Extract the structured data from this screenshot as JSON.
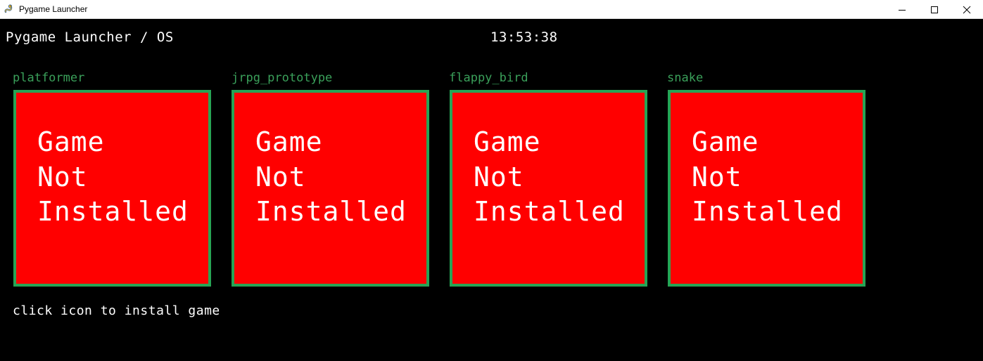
{
  "window": {
    "title": "Pygame Launcher",
    "icon": "pygame-snake-icon",
    "controls": [
      "minimize-icon",
      "maximize-icon",
      "close-icon"
    ]
  },
  "header": {
    "title": "Pygame Launcher / OS",
    "clock": "13:53:38"
  },
  "games": [
    {
      "name": "platformer",
      "status": [
        "Game",
        "Not",
        "Installed"
      ]
    },
    {
      "name": "jrpg_prototype",
      "status": [
        "Game",
        "Not",
        "Installed"
      ]
    },
    {
      "name": "flappy_bird",
      "status": [
        "Game",
        "Not",
        "Installed"
      ]
    },
    {
      "name": "snake",
      "status": [
        "Game",
        "Not",
        "Installed"
      ]
    }
  ],
  "hint": "click icon to install game",
  "colors": {
    "background": "#000000",
    "tile_fill": "#ff0000",
    "tile_border": "#27a455",
    "game_name": "#3aa05a",
    "text": "#ffffff"
  }
}
